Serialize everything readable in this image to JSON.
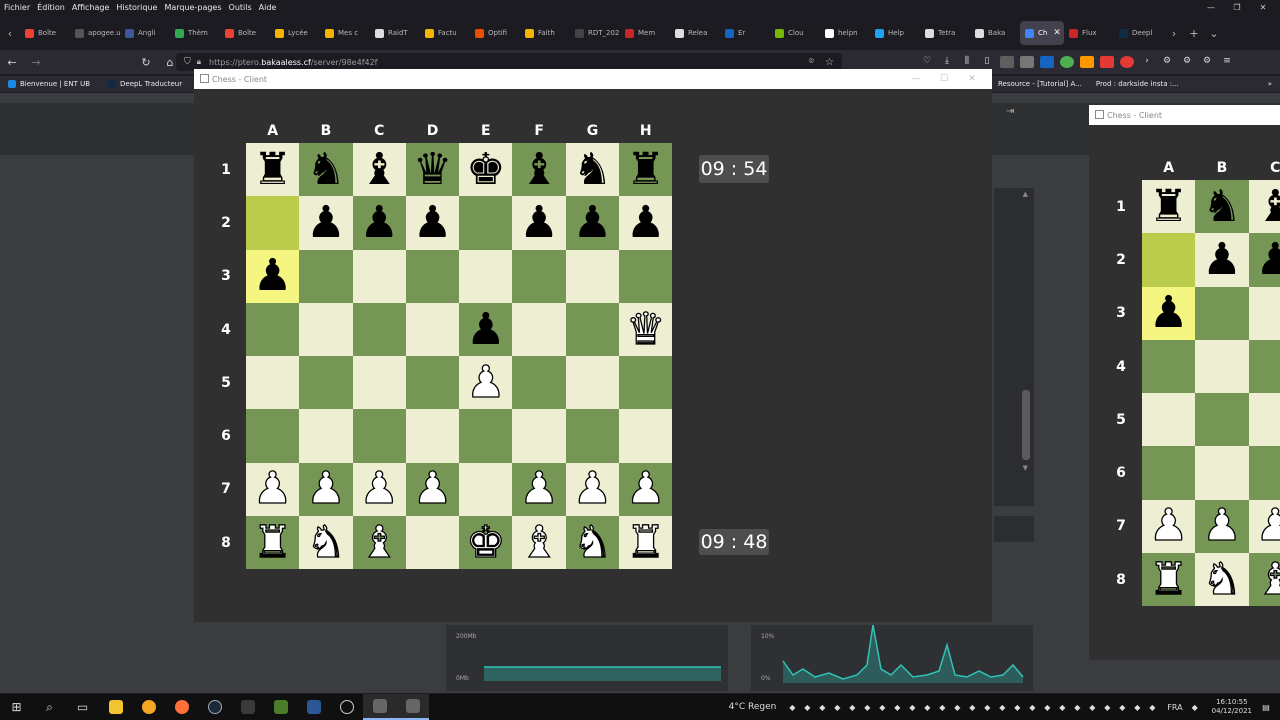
{
  "menubar": {
    "items": [
      "Fichier",
      "Édition",
      "Affichage",
      "Historique",
      "Marque-pages",
      "Outils",
      "Aide"
    ]
  },
  "tabs": [
    {
      "label": "Boîte",
      "color": "#ea4335"
    },
    {
      "label": "apogee.u",
      "color": "#555555"
    },
    {
      "label": "Angli",
      "color": "#3b5998"
    },
    {
      "label": "Thèm",
      "color": "#34a853"
    },
    {
      "label": "Boîte",
      "color": "#ea4335"
    },
    {
      "label": "Lycée",
      "color": "#f4b400"
    },
    {
      "label": "Mes c",
      "color": "#f4b400"
    },
    {
      "label": "RaidT",
      "color": "#dddddd"
    },
    {
      "label": "Factu",
      "color": "#f4b400"
    },
    {
      "label": "Optifi",
      "color": "#e65100"
    },
    {
      "label": "Faith",
      "color": "#f4b400"
    },
    {
      "label": "RDT_2021",
      "color": "#444444"
    },
    {
      "label": "Mem",
      "color": "#c62828"
    },
    {
      "label": "Relea",
      "color": "#dddddd"
    },
    {
      "label": "Er",
      "color": "#1565c0"
    },
    {
      "label": "Clou",
      "color": "#76b900"
    },
    {
      "label": "helpn",
      "color": "#ffffff"
    },
    {
      "label": "Help",
      "color": "#1da1f2"
    },
    {
      "label": "Tetra",
      "color": "#dddddd"
    },
    {
      "label": "Baka",
      "color": "#dddddd"
    },
    {
      "label": "Ch",
      "color": "#4285f4",
      "active": true
    },
    {
      "label": "Flux",
      "color": "#c62828"
    },
    {
      "label": "Deepl",
      "color": "#0f2b46"
    }
  ],
  "url": {
    "prefix": "https://ptero.",
    "domain": "bakaaless.cf",
    "suffix": "/server/98e4f42f"
  },
  "bookmarks": {
    "left": [
      {
        "label": "Bienvenue | ENT UB",
        "color": "#1e88e5"
      },
      {
        "label": "DeepL Traducteur",
        "color": "#0f2b46"
      }
    ],
    "right": [
      "Resource - [Tutorial] A...",
      "Prod : darkside insta :..."
    ]
  },
  "windows": {
    "main": {
      "title": "Chess - Client"
    },
    "side": {
      "title": "Chess - Client"
    }
  },
  "board": {
    "files": [
      "A",
      "B",
      "C",
      "D",
      "E",
      "F",
      "G",
      "H"
    ],
    "ranks": [
      "1",
      "2",
      "3",
      "4",
      "5",
      "6",
      "7",
      "8"
    ],
    "position": [
      [
        "bR",
        "bN",
        "bB",
        "bQ",
        "bK",
        "bB",
        "bN",
        "bR"
      ],
      [
        "",
        "bP",
        "bP",
        "bP",
        "",
        "bP",
        "bP",
        "bP"
      ],
      [
        "bP",
        "",
        "",
        "",
        "",
        "",
        "",
        ""
      ],
      [
        "",
        "",
        "",
        "",
        "bP",
        "",
        "",
        "wQ"
      ],
      [
        "",
        "",
        "",
        "",
        "wP",
        "",
        "",
        ""
      ],
      [
        "",
        "",
        "",
        "",
        "",
        "",
        "",
        ""
      ],
      [
        "wP",
        "wP",
        "wP",
        "wP",
        "",
        "wP",
        "wP",
        "wP"
      ],
      [
        "wR",
        "wN",
        "wB",
        "",
        "wK",
        "wB",
        "wN",
        "wR"
      ]
    ],
    "highlights": [
      {
        "rank": 2,
        "file": 1,
        "style": "hl"
      },
      {
        "rank": 3,
        "file": 1,
        "style": "hl2"
      }
    ],
    "colors": {
      "light": "#eeeed2",
      "dark": "#769656"
    }
  },
  "side_board": {
    "files": [
      "A",
      "B",
      "C"
    ],
    "ranks": [
      "1",
      "2",
      "3",
      "4",
      "5",
      "6",
      "7",
      "8"
    ],
    "position": [
      [
        "bR",
        "bN",
        "bB"
      ],
      [
        "",
        "bP",
        "bP"
      ],
      [
        "bP",
        "",
        ""
      ],
      [
        "",
        "",
        ""
      ],
      [
        "",
        "",
        ""
      ],
      [
        "",
        "",
        ""
      ],
      [
        "wP",
        "wP",
        "wP"
      ],
      [
        "wR",
        "wN",
        "wB"
      ]
    ]
  },
  "clocks": {
    "top": "09 : 54",
    "bottom": "09 : 48"
  },
  "graphs": [
    {
      "top_label": "200Mb",
      "bottom_label": "0Mb",
      "color": "#2ec4b6"
    },
    {
      "top_label": "10%",
      "bottom_label": "0%",
      "color": "#2ec4b6"
    }
  ],
  "taskbar": {
    "weather": "4°C  Regen",
    "language": "FRA",
    "time": "16:10:55",
    "date": "04/12/2021"
  }
}
